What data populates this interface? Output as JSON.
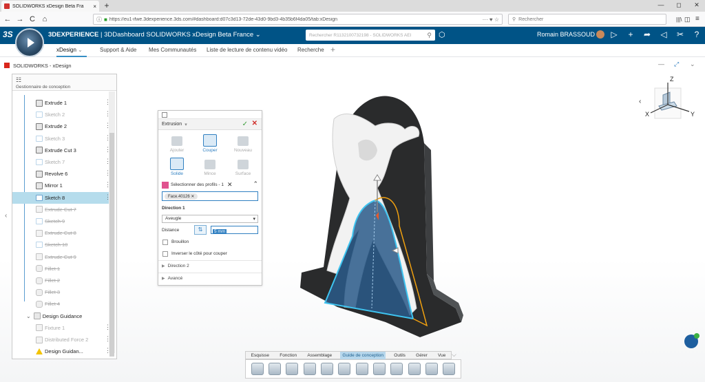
{
  "browser": {
    "tab_title": "SOLIDWORKS xDesign Beta Fra",
    "tab_close": "×",
    "new_tab": "+",
    "url": "https://eu1-ifwe.3dexperience.3ds.com/#dashboard:d07c3d13-72de-43d0-9bd3-4b35b6f4da05/tab:xDesign",
    "url_actions": "··· ♥ ☆",
    "search_placeholder": "Rechercher",
    "win_min": "—",
    "win_max": "◻",
    "win_close": "✕",
    "back": "←",
    "forward": "→",
    "reload": "C",
    "home": "⌂",
    "right_icons": [
      "|||\\",
      "◫",
      "≡"
    ]
  },
  "header": {
    "ds_logo": "3S",
    "brand": "3DEXPERIENCE",
    "dashboard": "3DDashboard SOLIDWORKS xDesign Beta France",
    "search_placeholder": "Rechercher R1132100732198 - SOLIDWORKS AEI",
    "user_name": "Romain BRASSOUD",
    "icons": [
      "share-icon",
      "add-icon",
      "forward-icon",
      "network-icon",
      "tools-icon",
      "help-icon"
    ]
  },
  "tabs": [
    "xDesign",
    "Support & Aide",
    "Mes Communautés",
    "Liste de lecture de contenu vidéo",
    "Recherche"
  ],
  "tab_add": "+",
  "widget": {
    "title": "SOLIDWORKS - xDesign",
    "actions": [
      "—",
      "⤢",
      "⌄"
    ]
  },
  "tree": {
    "title": "Gestionnaire de conception",
    "items": [
      {
        "label": "Extrude 1",
        "kind": "feat",
        "state": "normal"
      },
      {
        "label": "Sketch 2",
        "kind": "sketch",
        "state": "dim"
      },
      {
        "label": "Extrude 2",
        "kind": "feat",
        "state": "normal"
      },
      {
        "label": "Sketch 3",
        "kind": "sketch",
        "state": "dim"
      },
      {
        "label": "Extrude Cut 3",
        "kind": "feat",
        "state": "normal"
      },
      {
        "label": "Sketch 7",
        "kind": "sketch",
        "state": "dim"
      },
      {
        "label": "Revolve 6",
        "kind": "feat",
        "state": "normal"
      },
      {
        "label": "Mirror 1",
        "kind": "feat",
        "state": "normal"
      },
      {
        "label": "Sketch 8",
        "kind": "sketch",
        "state": "selected"
      },
      {
        "label": "Extrude Cut 7",
        "kind": "feat",
        "state": "suppressed"
      },
      {
        "label": "Sketch 9",
        "kind": "sketch",
        "state": "suppressed"
      },
      {
        "label": "Extrude Cut 8",
        "kind": "feat",
        "state": "suppressed"
      },
      {
        "label": "Sketch 10",
        "kind": "sketch",
        "state": "suppressed"
      },
      {
        "label": "Extrude Cut 9",
        "kind": "feat",
        "state": "suppressed"
      },
      {
        "label": "Fillet 1",
        "kind": "fillet",
        "state": "suppressed"
      },
      {
        "label": "Fillet 2",
        "kind": "fillet",
        "state": "suppressed"
      },
      {
        "label": "Fillet 3",
        "kind": "fillet",
        "state": "suppressed"
      },
      {
        "label": "Fillet 4",
        "kind": "fillet",
        "state": "suppressed"
      },
      {
        "label": "Design Guidance",
        "kind": "group",
        "state": "normal"
      },
      {
        "label": "Fixture 1",
        "kind": "fixture",
        "state": "dim"
      },
      {
        "label": "Distributed Force 2",
        "kind": "force",
        "state": "dim"
      },
      {
        "label": "Design Guidan...",
        "kind": "warn",
        "state": "normal"
      }
    ]
  },
  "dialog": {
    "title": "Extrusion",
    "ok": "✓",
    "cancel": "✕",
    "ops": [
      "Ajouter",
      "Couper",
      "Nouveau"
    ],
    "ops_active": "Couper",
    "types": [
      "Solide",
      "Mince",
      "Surface"
    ],
    "types_active": "Solide",
    "profiles_label": "Sélectionner des profils - 1",
    "selected_face": "Face.40126",
    "direction1": "Direction 1",
    "end_condition": "Aveugle",
    "distance_label": "Distance",
    "distance_value": "5 mm",
    "draft": "Brouillon",
    "flip_side": "Inverser le côté pour couper",
    "direction2": "Direction 2",
    "advanced": "Avancé"
  },
  "triad": {
    "z": "Z",
    "x": "X",
    "y": "Y"
  },
  "bottom_tabs": [
    "Esquisse",
    "Fonction",
    "Assemblage",
    "Guide de conception",
    "Outils",
    "Gérer",
    "Vue"
  ],
  "bottom_tab_active": "Guide de conception",
  "bottom_tools": [
    "extrude-icon",
    "extrude-cut-icon",
    "revolve-icon",
    "sweep-icon",
    "undo-icon",
    "redo-icon",
    "sketch-icon",
    "dimension-icon",
    "measure-icon",
    "view-icon",
    "section-icon",
    "render-icon"
  ],
  "colors": {
    "brand_bar": "#005386",
    "accent": "#2f7fc1",
    "selection": "#b5dcec",
    "model_dark": "#2a2b2c",
    "model_light": "#f2f2f2",
    "cut_face": "#2a5b8a",
    "highlight_edge": "#3ec4f0",
    "preview_edge": "#f0a010"
  }
}
